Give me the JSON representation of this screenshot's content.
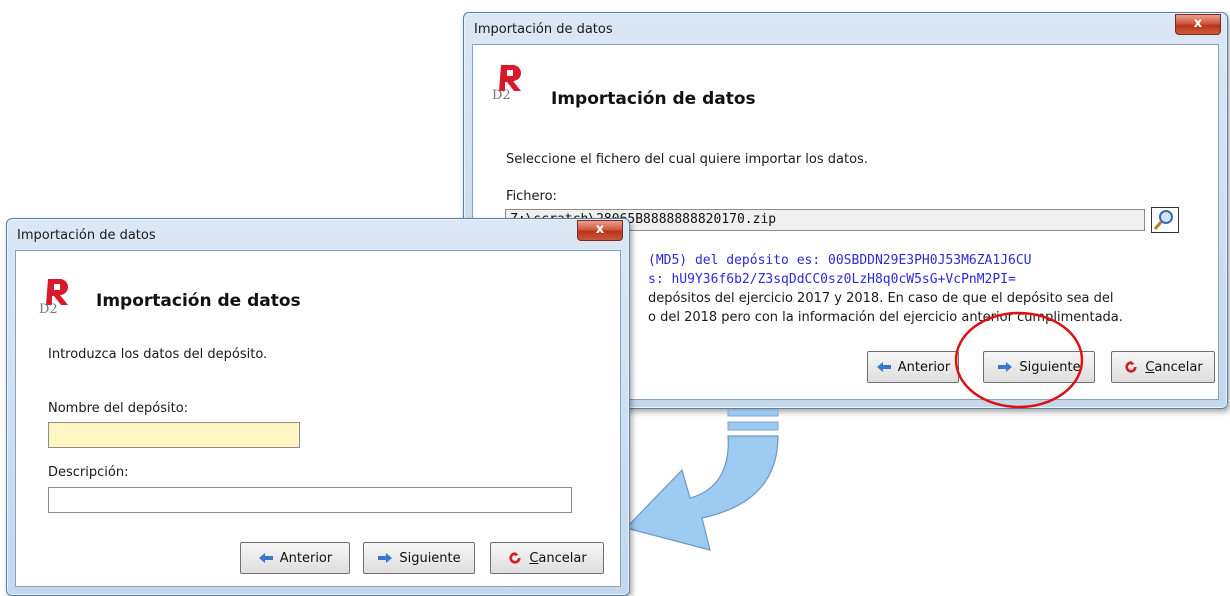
{
  "window_back": {
    "title": "Importación de datos",
    "close_label": "x",
    "header_title": "Importación de datos",
    "instruction": "Seleccione el fichero del cual quiere importar los datos.",
    "file_label": "Fichero:",
    "file_value": "Z:\\scratch\\28065B8888888820170.zip",
    "hash_md5": "(MD5) del depósito es: 00SBDDN29E3PH0J53M6ZA1J6CU",
    "hash_sha": "s: hU9Y36f6b2/Z3sqDdCC0sz0LzH8q0cW5sG+VcPnM2PI=",
    "info_line1": "depósitos del ejercicio 2017 y 2018. En caso de que el depósito sea del",
    "info_line2": "o del 2018 pero con la información del ejercicio anterior cumplimentada.",
    "buttons": {
      "anterior": "Anterior",
      "siguiente": "Siguiente",
      "cancelar_first": "C",
      "cancelar_rest": "ancelar"
    }
  },
  "window_front": {
    "title": "Importación de datos",
    "close_label": "x",
    "header_title": "Importación de datos",
    "instruction": "Introduzca los datos del depósito.",
    "name_label": "Nombre del depósito:",
    "name_value": "",
    "desc_label": "Descripción:",
    "desc_value": "",
    "buttons": {
      "anterior": "Anterior",
      "siguiente": "Siguiente",
      "cancelar_first": "C",
      "cancelar_rest": "ancelar"
    }
  },
  "colors": {
    "highlight_circle": "#e01010",
    "arrow_fill": "#9ccaf0",
    "name_field_bg": "#fff6c4",
    "hash_text": "#2b2bd8"
  },
  "icons": [
    "d2r-logo-icon",
    "search-magnifier-icon",
    "arrow-left-icon",
    "arrow-right-icon",
    "cancel-icon",
    "close-icon"
  ]
}
